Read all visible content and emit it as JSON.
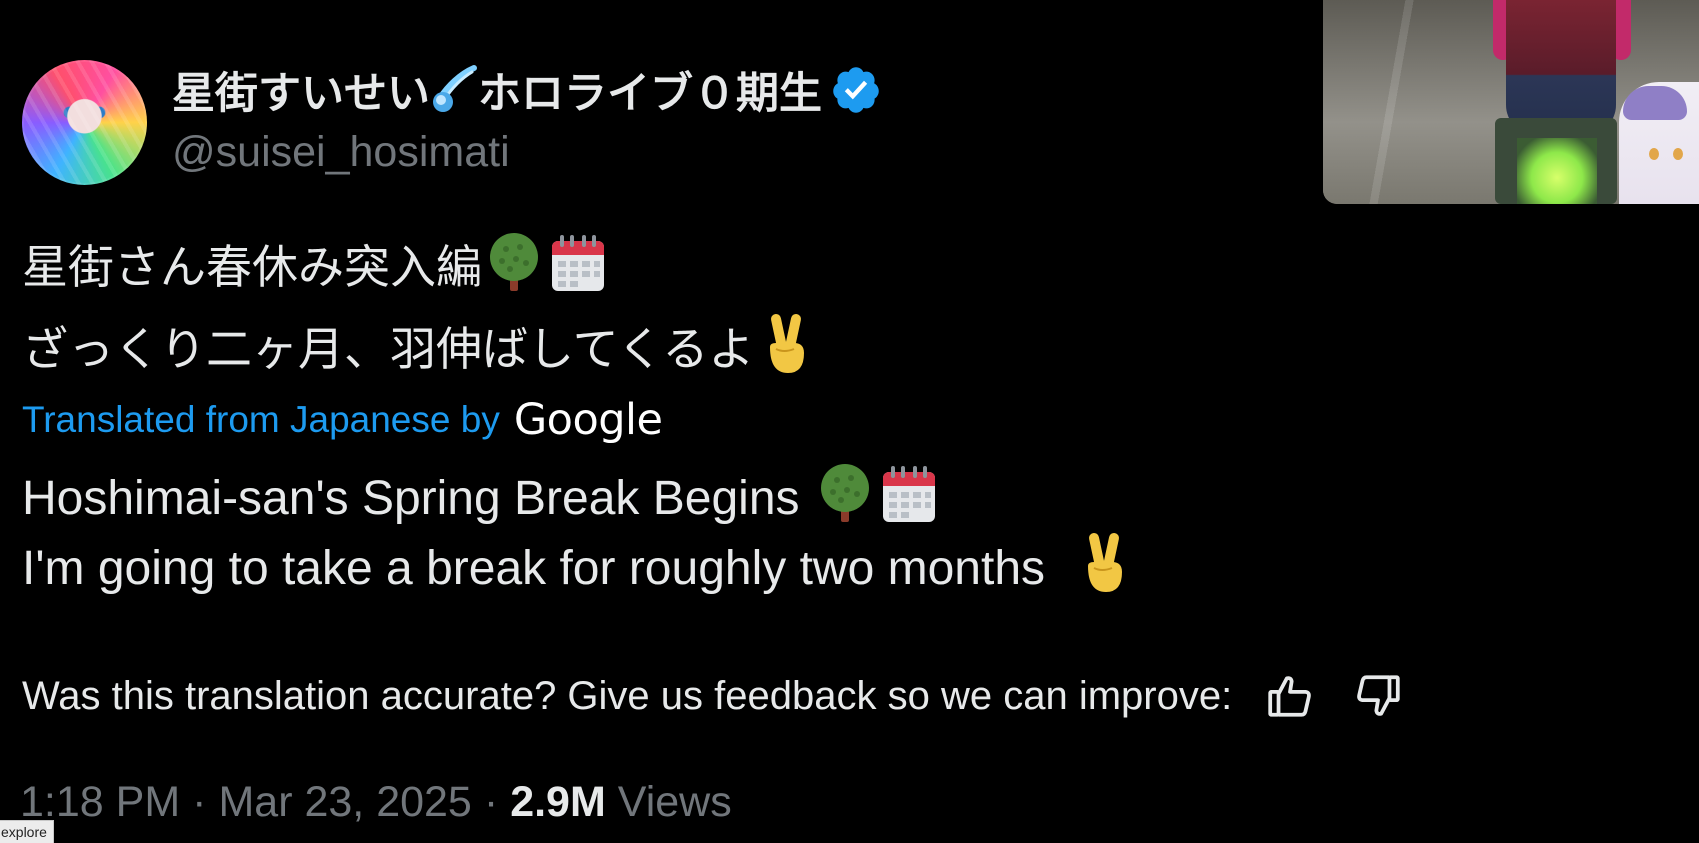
{
  "author": {
    "display_name": "星街すいせい☄️ホロライブ０期生",
    "display_name_text": "星街すいせい",
    "display_name_suffix": "ホロライブ０期生",
    "handle": "@suisei_hosimati",
    "verified": true,
    "avatar_icon": "avatar-image",
    "badge_icon": "verified-badge-icon",
    "comet_icon": "comet-emoji-icon"
  },
  "tweet": {
    "original_lines": [
      "星街さん春休み突入編",
      "ざっくり二ヶ月、羽伸ばしてくるよ"
    ],
    "original_line1_emojis": [
      "tree-emoji-icon",
      "calendar-emoji-icon"
    ],
    "original_line2_emojis": [
      "victory-hand-emoji-icon"
    ],
    "translation_label": "Translated from Japanese by",
    "translation_provider": "Google",
    "translated_lines": [
      "Hoshimai-san's Spring Break Begins",
      "I'm going to take a break for roughly two months"
    ],
    "translated_line1_emojis": [
      "tree-emoji-icon",
      "calendar-emoji-icon"
    ],
    "translated_line2_emojis": [
      "victory-hand-emoji-icon"
    ]
  },
  "feedback": {
    "prompt": "Was this translation accurate? Give us feedback so we can improve:",
    "thumbs_up_icon": "thumbs-up-icon",
    "thumbs_down_icon": "thumbs-down-icon"
  },
  "meta": {
    "time": "1:18 PM",
    "separator": "·",
    "date": "Mar 23, 2025",
    "views_count": "2.9M",
    "views_label": "Views"
  },
  "status_bar": {
    "url_text": "explore"
  },
  "colors": {
    "background": "#000000",
    "text_primary": "#e7e9ea",
    "text_secondary": "#71767b",
    "link_blue": "#1d9bf0",
    "verified_blue": "#1d9bf0"
  }
}
